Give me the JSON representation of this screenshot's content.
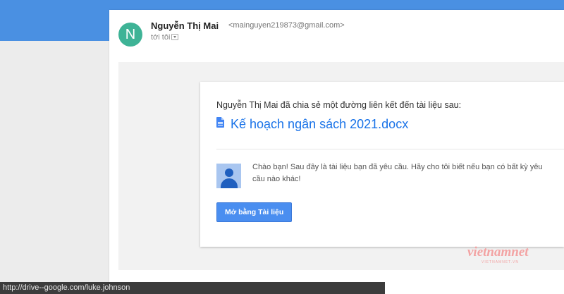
{
  "email": {
    "sender_initial": "N",
    "sender_name": "Nguyễn Thị Mai",
    "sender_email": "<mainguyen219873@gmail.com>",
    "to_label": "tới tôi"
  },
  "share": {
    "intro": "Nguyễn Thị Mai đã chia sẻ một đường liên kết đến tài liệu sau:",
    "doc_title": "Kế hoạch ngân sách 2021.docx",
    "message": "Chào bạn! Sau đây là tài liệu bạn đã yêu cầu. Hãy cho tôi biết nếu bạn có bất kỳ yêu cầu nào khác!",
    "open_button": "Mở bằng Tài liệu"
  },
  "status_bar": {
    "url": "http://drive--google.com/luke.johnson"
  },
  "watermark": {
    "text": "vietnamnet",
    "sub": "VIETNAMNET.VN"
  },
  "colors": {
    "top_band": "#4a90e2",
    "avatar": "#3eb396",
    "link": "#1a73e8",
    "button": "#4a8ef0",
    "doc_icon": "#4285f4"
  },
  "icons": {
    "doc": "google-docs-icon",
    "dropdown": "chevron-down-icon",
    "person": "person-icon"
  }
}
